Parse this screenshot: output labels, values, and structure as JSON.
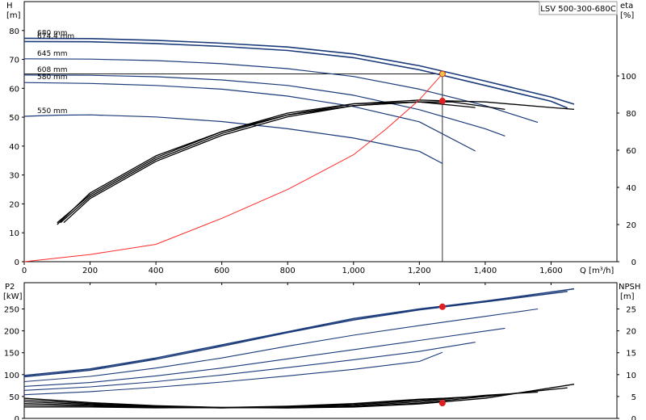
{
  "model": "LSV 500-300-680C",
  "chart_data": [
    {
      "id": "head",
      "type": "line",
      "xlabel": "Q [m³/h]",
      "ylabel_line1": "H",
      "ylabel_line2": "[m]",
      "y2label_line1": "eta",
      "y2label_line2": "[%]",
      "xlim": [
        0,
        1800
      ],
      "ylim": [
        0,
        90
      ],
      "y2lim": [
        0,
        140
      ],
      "xticks": [
        0,
        200,
        400,
        600,
        800,
        1000,
        1200,
        1400,
        1600
      ],
      "xtick_labels": [
        "0",
        "200",
        "400",
        "600",
        "800",
        "1,000",
        "1,200",
        "1,400",
        "1,600"
      ],
      "yticks": [
        0,
        10,
        20,
        30,
        40,
        50,
        60,
        70,
        80
      ],
      "y2ticks": [
        0,
        20,
        40,
        60,
        80,
        100
      ],
      "grid": false,
      "series": [
        {
          "name": "680 mm",
          "color": "#1a3a7a",
          "width": 1.6,
          "points": [
            [
              0,
              77.3
            ],
            [
              200,
              77.2
            ],
            [
              400,
              76.6
            ],
            [
              600,
              75.6
            ],
            [
              800,
              74.3
            ],
            [
              1000,
              71.9
            ],
            [
              1200,
              67.8
            ],
            [
              1400,
              62.5
            ],
            [
              1600,
              57.0
            ],
            [
              1670,
              54.5
            ]
          ]
        },
        {
          "name": "674,4 mm",
          "color": "#1a3a7a",
          "width": 1.6,
          "points": [
            [
              0,
              76.2
            ],
            [
              200,
              76.1
            ],
            [
              400,
              75.5
            ],
            [
              600,
              74.5
            ],
            [
              800,
              73.1
            ],
            [
              1000,
              70.6
            ],
            [
              1200,
              66.4
            ],
            [
              1400,
              61.0
            ],
            [
              1600,
              55.5
            ],
            [
              1650,
              53.2
            ]
          ]
        },
        {
          "name": "645 mm",
          "color": "#1a3a7a",
          "width": 1.2,
          "points": [
            [
              0,
              70.2
            ],
            [
              200,
              70.1
            ],
            [
              400,
              69.6
            ],
            [
              600,
              68.5
            ],
            [
              800,
              66.8
            ],
            [
              1000,
              64.1
            ],
            [
              1200,
              59.7
            ],
            [
              1400,
              54.0
            ],
            [
              1560,
              48.2
            ]
          ]
        },
        {
          "name": "608 mm",
          "color": "#1a3a7a",
          "width": 1.2,
          "points": [
            [
              0,
              64.6
            ],
            [
              200,
              64.5
            ],
            [
              400,
              64.0
            ],
            [
              600,
              62.9
            ],
            [
              800,
              61.0
            ],
            [
              1000,
              57.6
            ],
            [
              1200,
              52.6
            ],
            [
              1400,
              46.0
            ],
            [
              1460,
              43.5
            ]
          ]
        },
        {
          "name": "580 mm",
          "color": "#1a3a7a",
          "width": 1.2,
          "points": [
            [
              0,
              62.0
            ],
            [
              200,
              61.7
            ],
            [
              400,
              61.0
            ],
            [
              600,
              59.7
            ],
            [
              800,
              57.3
            ],
            [
              1000,
              53.7
            ],
            [
              1200,
              48.4
            ],
            [
              1370,
              38.3
            ]
          ]
        },
        {
          "name": "550 mm",
          "color": "#1a3a7a",
          "width": 1.2,
          "points": [
            [
              0,
              50.3
            ],
            [
              100,
              50.7
            ],
            [
              200,
              50.8
            ],
            [
              400,
              50.1
            ],
            [
              600,
              48.5
            ],
            [
              800,
              46.0
            ],
            [
              1000,
              42.8
            ],
            [
              1200,
              38.2
            ],
            [
              1270,
              34.0
            ]
          ]
        },
        {
          "name": "",
          "axis": "y2",
          "color": "#000000",
          "width": 1.3,
          "points": [
            [
              100,
              21
            ],
            [
              200,
              36
            ],
            [
              400,
              56
            ],
            [
              600,
              70
            ],
            [
              800,
              80
            ],
            [
              1000,
              85
            ],
            [
              1200,
              87
            ],
            [
              1400,
              86
            ],
            [
              1600,
              83
            ],
            [
              1670,
              82
            ]
          ]
        },
        {
          "name": "",
          "axis": "y2",
          "color": "#000000",
          "width": 1.3,
          "points": [
            [
              110,
              21
            ],
            [
              200,
              35
            ],
            [
              400,
              55
            ],
            [
              600,
              69
            ],
            [
              800,
              79
            ],
            [
              1000,
              84
            ],
            [
              1200,
              86
            ],
            [
              1300,
              86
            ],
            [
              1460,
              82
            ]
          ]
        },
        {
          "name": "",
          "axis": "y2",
          "color": "#000000",
          "width": 1.3,
          "points": [
            [
              120,
              21
            ],
            [
              200,
              34
            ],
            [
              400,
              54
            ],
            [
              600,
              68
            ],
            [
              800,
              78
            ],
            [
              1000,
              84
            ],
            [
              1200,
              86
            ],
            [
              1370,
              83
            ]
          ]
        },
        {
          "name": "",
          "axis": "y2",
          "color": "#000000",
          "width": 1.3,
          "points": [
            [
              100,
              20
            ],
            [
              200,
              37
            ],
            [
              400,
              57
            ],
            [
              600,
              70
            ],
            [
              800,
              79
            ],
            [
              1000,
              85
            ],
            [
              1200,
              86
            ],
            [
              1270,
              85
            ]
          ]
        },
        {
          "name": "",
          "color": "#ff2a2a",
          "width": 1.0,
          "points": [
            [
              0,
              0
            ],
            [
              200,
              2.5
            ],
            [
              400,
              6
            ],
            [
              600,
              15
            ],
            [
              800,
              25
            ],
            [
              1000,
              37
            ],
            [
              1100,
              46
            ],
            [
              1200,
              56
            ],
            [
              1270,
              65
            ]
          ]
        }
      ],
      "markers": [
        {
          "x": 1270,
          "y": 65,
          "color": "#f5c242",
          "stroke": "#c0392b"
        },
        {
          "x": 1270,
          "y": 86.5,
          "axis": "y2",
          "color": "#e02020",
          "stroke": "#e02020"
        }
      ],
      "guides": [
        {
          "x1": 0,
          "y1": 65,
          "x2": 1270,
          "y2": 65
        },
        {
          "x1": 1270,
          "y1": 65,
          "x2": 1270,
          "y2": 0
        }
      ]
    },
    {
      "id": "power",
      "type": "line",
      "ylabel_line1": "P2",
      "ylabel_line2": "[kW]",
      "y2label_line1": "NPSH",
      "y2label_line2": "[m]",
      "xlim": [
        0,
        1800
      ],
      "ylim": [
        0,
        310
      ],
      "y2lim": [
        0,
        31
      ],
      "yticks": [
        0,
        50,
        100,
        150,
        200,
        250
      ],
      "y2ticks": [
        0,
        5,
        10,
        15,
        20,
        25
      ],
      "grid": false,
      "series": [
        {
          "name": "",
          "color": "#1a3a7a",
          "width": 1.5,
          "points": [
            [
              0,
              98
            ],
            [
              200,
              113
            ],
            [
              400,
              138
            ],
            [
              600,
              168
            ],
            [
              800,
              198
            ],
            [
              1000,
              228
            ],
            [
              1200,
              250
            ],
            [
              1400,
              268
            ],
            [
              1670,
              296
            ]
          ]
        },
        {
          "name": "",
          "color": "#1a3a7a",
          "width": 1.5,
          "points": [
            [
              0,
              95
            ],
            [
              200,
              110
            ],
            [
              400,
              135
            ],
            [
              600,
              165
            ],
            [
              800,
              196
            ],
            [
              1000,
              225
            ],
            [
              1200,
              248
            ],
            [
              1400,
              266
            ],
            [
              1650,
              290
            ]
          ]
        },
        {
          "name": "",
          "color": "#1a3a7a",
          "width": 1.1,
          "points": [
            [
              0,
              84
            ],
            [
              200,
              96
            ],
            [
              400,
              115
            ],
            [
              600,
              138
            ],
            [
              800,
              165
            ],
            [
              1000,
              190
            ],
            [
              1200,
              212
            ],
            [
              1400,
              233
            ],
            [
              1560,
              250
            ]
          ]
        },
        {
          "name": "",
          "color": "#1a3a7a",
          "width": 1.1,
          "points": [
            [
              0,
              73
            ],
            [
              200,
              82
            ],
            [
              400,
              97
            ],
            [
              600,
              115
            ],
            [
              800,
              136
            ],
            [
              1000,
              157
            ],
            [
              1200,
              178
            ],
            [
              1460,
              206
            ]
          ]
        },
        {
          "name": "",
          "color": "#1a3a7a",
          "width": 1.1,
          "points": [
            [
              0,
              64
            ],
            [
              200,
              72
            ],
            [
              400,
              84
            ],
            [
              600,
              99
            ],
            [
              800,
              116
            ],
            [
              1000,
              134
            ],
            [
              1200,
              153
            ],
            [
              1370,
              174
            ]
          ]
        },
        {
          "name": "",
          "color": "#1a3a7a",
          "width": 1.1,
          "points": [
            [
              0,
              54
            ],
            [
              200,
              61
            ],
            [
              400,
              71
            ],
            [
              600,
              83
            ],
            [
              800,
              97
            ],
            [
              1000,
              112
            ],
            [
              1200,
              130
            ],
            [
              1270,
              151
            ]
          ]
        },
        {
          "name": "",
          "axis": "y2",
          "color": "#000000",
          "width": 1.4,
          "points": [
            [
              0,
              4.6
            ],
            [
              200,
              3.6
            ],
            [
              400,
              2.9
            ],
            [
              600,
              2.5
            ],
            [
              800,
              2.4
            ],
            [
              1000,
              2.6
            ],
            [
              1200,
              3.3
            ],
            [
              1400,
              4.6
            ],
            [
              1670,
              7.8
            ]
          ]
        },
        {
          "name": "",
          "axis": "y2",
          "color": "#000000",
          "width": 1.2,
          "points": [
            [
              0,
              4.2
            ],
            [
              200,
              3.4
            ],
            [
              400,
              2.8
            ],
            [
              600,
              2.5
            ],
            [
              800,
              2.4
            ],
            [
              1000,
              2.7
            ],
            [
              1200,
              3.5
            ],
            [
              1400,
              5.0
            ],
            [
              1650,
              7.0
            ]
          ]
        },
        {
          "name": "",
          "axis": "y2",
          "color": "#000000",
          "width": 1.2,
          "points": [
            [
              0,
              3.8
            ],
            [
              200,
              3.2
            ],
            [
              400,
              2.7
            ],
            [
              600,
              2.4
            ],
            [
              800,
              2.5
            ],
            [
              1000,
              2.9
            ],
            [
              1200,
              3.8
            ],
            [
              1400,
              5.3
            ],
            [
              1560,
              6.0
            ]
          ]
        },
        {
          "name": "",
          "axis": "y2",
          "color": "#000000",
          "width": 1.2,
          "points": [
            [
              0,
              3.4
            ],
            [
              200,
              3.0
            ],
            [
              400,
              2.6
            ],
            [
              600,
              2.4
            ],
            [
              800,
              2.6
            ],
            [
              1000,
              3.1
            ],
            [
              1200,
              4.1
            ],
            [
              1460,
              5.4
            ]
          ]
        },
        {
          "name": "",
          "axis": "y2",
          "color": "#000000",
          "width": 1.2,
          "points": [
            [
              0,
              3.0
            ],
            [
              200,
              2.8
            ],
            [
              400,
              2.5
            ],
            [
              600,
              2.4
            ],
            [
              800,
              2.7
            ],
            [
              1000,
              3.3
            ],
            [
              1200,
              4.3
            ],
            [
              1370,
              5.0
            ]
          ]
        },
        {
          "name": "",
          "axis": "y2",
          "color": "#000000",
          "width": 1.2,
          "points": [
            [
              0,
              2.6
            ],
            [
              200,
              2.6
            ],
            [
              400,
              2.4
            ],
            [
              600,
              2.5
            ],
            [
              800,
              2.8
            ],
            [
              1000,
              3.4
            ],
            [
              1200,
              4.4
            ],
            [
              1270,
              4.6
            ]
          ]
        }
      ],
      "markers": [
        {
          "x": 1270,
          "y": 255,
          "color": "#e02020",
          "stroke": "#e02020"
        },
        {
          "x": 1270,
          "y": 3.5,
          "axis": "y2",
          "color": "#e02020",
          "stroke": "#e02020"
        }
      ],
      "guides": []
    }
  ]
}
